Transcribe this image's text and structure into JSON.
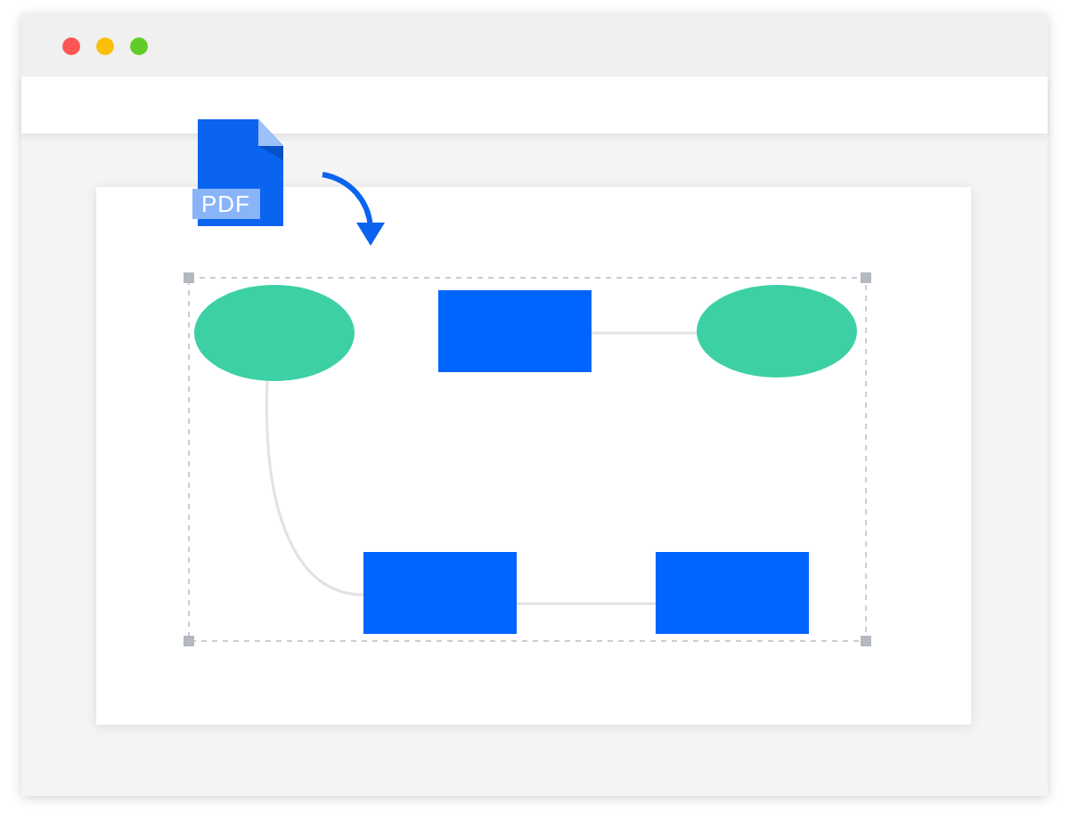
{
  "window_controls": [
    {
      "color": "#fd5454"
    },
    {
      "color": "#fbbf0a"
    },
    {
      "color": "#5fcc29"
    }
  ],
  "file_icon": {
    "label": "PDF"
  },
  "diagram": {
    "nodes": [
      {
        "kind": "ellipse"
      },
      {
        "kind": "rectangle"
      },
      {
        "kind": "ellipse"
      },
      {
        "kind": "rectangle"
      },
      {
        "kind": "rectangle"
      }
    ]
  }
}
